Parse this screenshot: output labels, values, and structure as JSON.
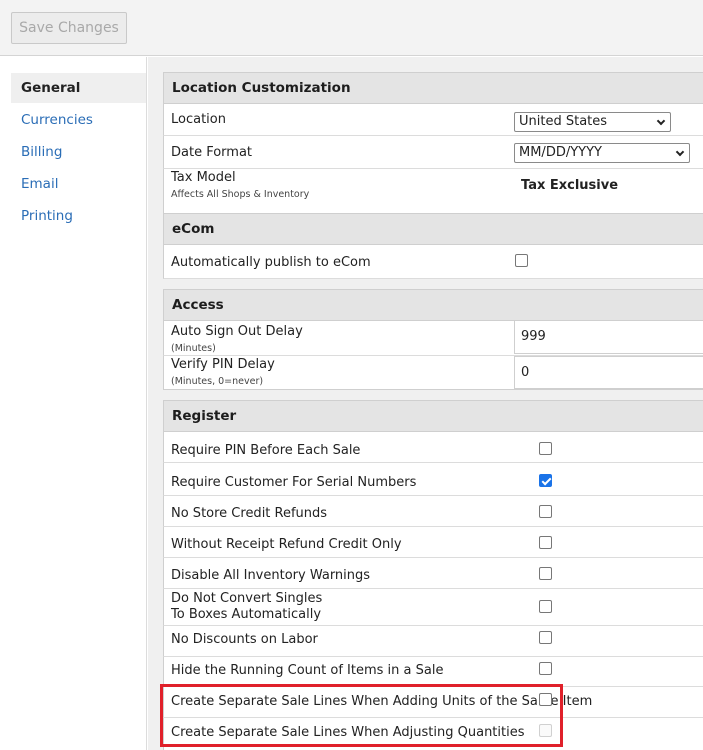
{
  "toolbar": {
    "save_label": "Save Changes"
  },
  "sidebar": {
    "items": [
      {
        "label": "General",
        "active": true
      },
      {
        "label": "Currencies"
      },
      {
        "label": "Billing"
      },
      {
        "label": "Email"
      },
      {
        "label": "Printing"
      }
    ]
  },
  "location_customization": {
    "header": "Location Customization",
    "location_label": "Location",
    "location_value": "United States",
    "date_format_label": "Date Format",
    "date_format_value": "MM/DD/YYYY",
    "tax_model_label": "Tax Model",
    "tax_model_sub": "Affects All Shops & Inventory",
    "tax_model_value": "Tax Exclusive"
  },
  "ecom": {
    "header": "eCom",
    "auto_publish_label": "Automatically publish to eCom",
    "auto_publish_checked": false
  },
  "access": {
    "header": "Access",
    "auto_signout_label": "Auto Sign Out Delay",
    "auto_signout_sub": "(Minutes)",
    "auto_signout_value": "999",
    "verify_pin_label": "Verify PIN Delay",
    "verify_pin_sub": "(Minutes, 0=never)",
    "verify_pin_value": "0"
  },
  "register": {
    "header": "Register",
    "items": [
      {
        "label": "Require PIN Before Each Sale",
        "checked": false
      },
      {
        "label": "Require Customer For Serial Numbers",
        "checked": true
      },
      {
        "label": "No Store Credit Refunds",
        "checked": false
      },
      {
        "label": "Without Receipt Refund Credit Only",
        "checked": false
      },
      {
        "label": "Disable All Inventory Warnings",
        "checked": false
      },
      {
        "label_line1": "Do Not Convert Singles",
        "label_line2": "To Boxes Automatically",
        "checked": false
      },
      {
        "label": "No Discounts on Labor",
        "checked": false
      },
      {
        "label": "Hide the Running Count of Items in a Sale",
        "checked": false
      },
      {
        "label": "Create Separate Sale Lines When Adding Units of the Same Item",
        "checked": false
      },
      {
        "label": "Create Separate Sale Lines When Adjusting Quantities",
        "checked": false,
        "disabled": true
      }
    ]
  },
  "colors": {
    "accent": "#1a73e8",
    "link": "#2a6db6",
    "highlight": "#e0202a"
  }
}
